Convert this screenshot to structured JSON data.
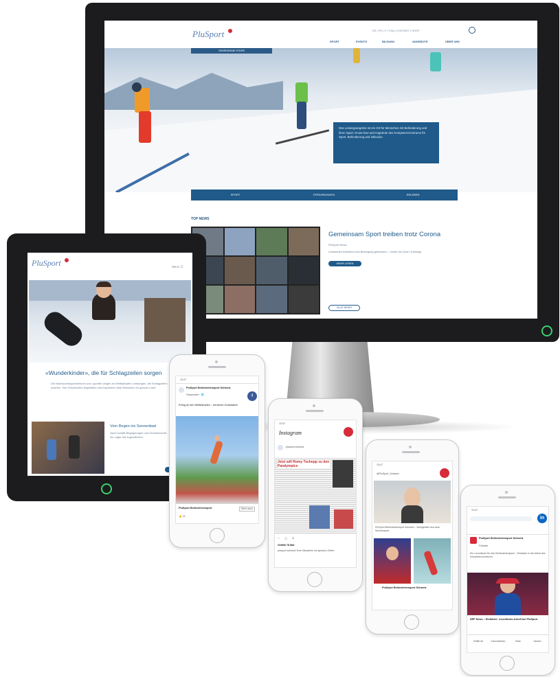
{
  "desktop": {
    "logo_text": "PluSport",
    "utility_links": "DE | FR | IT | FAQ | KONTAKT | SHOP",
    "nav": [
      "SPORT",
      "EVENTS",
      "BILDUNG",
      "ANGEBOTE",
      "ÜBER UNS"
    ],
    "hero_tag": "GEMEINSAM STARK",
    "hero_box_text": "Das Leitungsangebot ist ein Ort für Menschen mit Behinderung und ihren Sport. Know-how und Angebote des Kompetenzzentrums für Sport, Behinderung und Inklusion.",
    "tabs": [
      "SPORT",
      "ERFAHRUNGEN",
      "ERLEBEN"
    ],
    "top_news_label": "TOP NEWS",
    "news_title": "Gemeinsam Sport treiben trotz Corona",
    "news_meta": "PluSport News",
    "news_teaser": "Zusammen trainieren und Bewegung geniessen – online via Zoom-Trainings.",
    "read_more": "MEHR LESEN",
    "all_news": "ALLE NEWS"
  },
  "tablet": {
    "logo_text": "PluSport",
    "menu_label": "Menu ☰",
    "headline": "«Wunderkinder», die für Schlagzeilen sorgen",
    "paragraph": "Die Nachwuchssportlerinnen und -sportler zeigen an Wettkämpfen Leistungen, die Schlagzeilen machen. Ihre Geschichten begeistern und inspirieren viele Menschen im ganzen Land.",
    "teaser_title": "Vom Regen ins Sonnenbad",
    "teaser_text": "Sport schafft Begegnungen und Gemeinschaft – Einblicke in ein Lager mit Jugendlichen."
  },
  "phone_facebook": {
    "time": "13:47",
    "page_name": "PluSport Behindertensport Schweiz",
    "post_meta": "Gesponsert · 🌐",
    "post_text": "Erfolg an den Wettkämpfen – herzliche Gratulation!",
    "link_title": "PluSport Behindertensport",
    "cta": "Mehr dazu",
    "reactions": "👍 24"
  },
  "phone_instagram": {
    "time": "13:47",
    "logo": "Instagram",
    "story_label": "plusport.schweiz",
    "headline": "Jetzt will Romy Tschopp zu den Paralympics",
    "likes": "Gefällt 78 Mal",
    "caption": "plusport.schweiz Eine Kämpferin mit grossen Zielen."
  },
  "phone_twitter": {
    "time": "13:47",
    "handle": "@PluSport_Schweiz",
    "tweet_text": "PluSport Behindertensport Schweiz – Neuigkeiten aus dem Schneesport.",
    "tweet2_text": "PluSport Behindertensport Schweiz"
  },
  "phone_linkedin": {
    "time": "13:47",
    "page_name": "PluSport Behindertensport Schweiz",
    "followers": "Follower",
    "post_text": "Ein Leuchtturm für den Behindertensport – Einblicke in die Arbeit des Kompetenzzentrums.",
    "article_title": "SRF News – Einblicke: Leuchtturm-Arbeit bei PluSport",
    "actions": [
      "Gefällt mir",
      "Kommentieren",
      "Teilen",
      "Senden"
    ]
  },
  "colors": {
    "brand_blue": "#1f5a8a",
    "brand_red": "#d62b3a",
    "bezel": "#1c1c1e",
    "power_led": "#3bd16f"
  }
}
